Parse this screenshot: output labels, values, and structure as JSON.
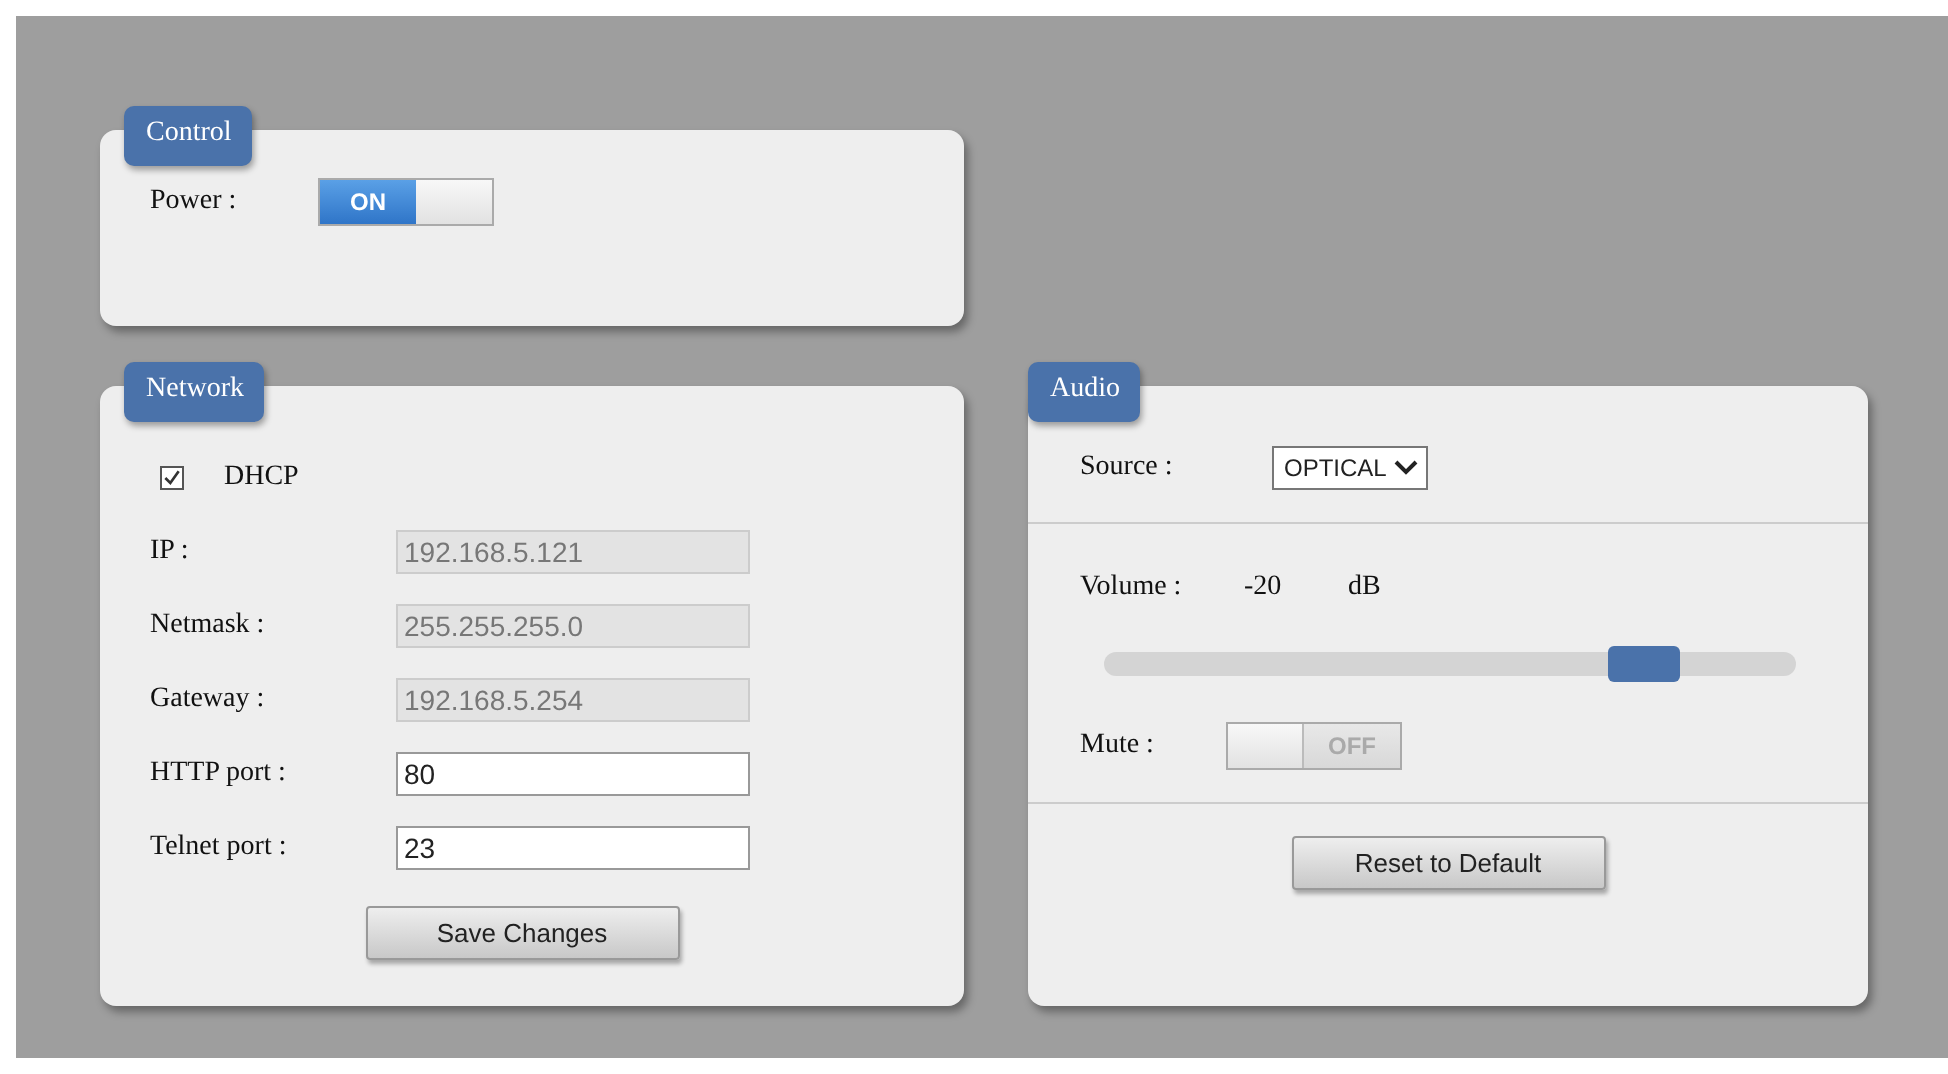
{
  "control": {
    "title": "Control",
    "power": {
      "label": "Power :",
      "on": true,
      "text": "ON"
    }
  },
  "network": {
    "title": "Network",
    "dhcp": {
      "label": "DHCP",
      "checked": true
    },
    "fields": [
      {
        "label": "IP :",
        "value": "192.168.5.121",
        "disabled": true
      },
      {
        "label": "Netmask :",
        "value": "255.255.255.0",
        "disabled": true
      },
      {
        "label": "Gateway :",
        "value": "192.168.5.254",
        "disabled": true
      },
      {
        "label": "HTTP port :",
        "value": "80",
        "disabled": false
      },
      {
        "label": "Telnet port :",
        "value": "23",
        "disabled": false
      }
    ],
    "button": "Save Changes"
  },
  "audio": {
    "title": "Audio",
    "source": {
      "label": "Source :",
      "value": "OPTICAL"
    },
    "volume": {
      "label": "Volume :",
      "reading": "-20",
      "unit": "dB",
      "level": 0.78
    },
    "mute": {
      "label": "Mute :",
      "on": false,
      "text": "OFF"
    },
    "button": "Reset to Default"
  }
}
